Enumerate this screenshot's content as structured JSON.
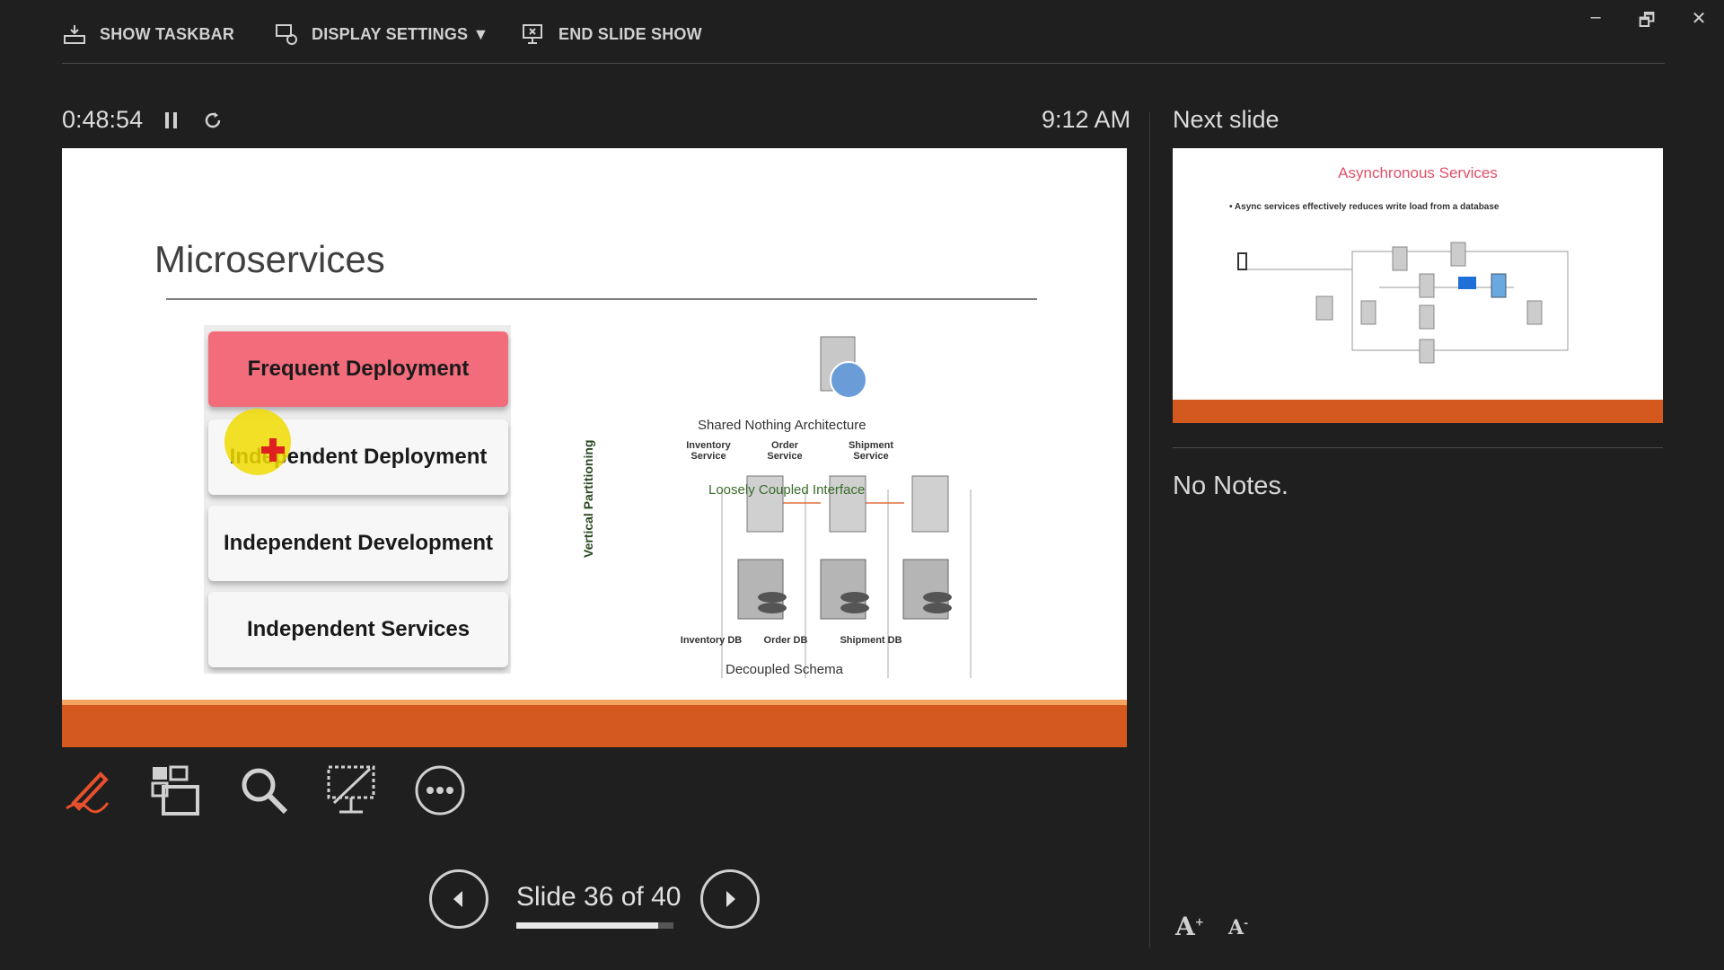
{
  "toolbar": {
    "show_taskbar": "SHOW TASKBAR",
    "display_settings": "DISPLAY SETTINGS ▼",
    "end_slide_show": "END SLIDE SHOW"
  },
  "window_controls": {
    "minimize": "–",
    "restore": "🗗",
    "close": "✕"
  },
  "presenter": {
    "elapsed": "0:48:54",
    "clock": "9:12 AM",
    "next_slide_label": "Next slide",
    "notes": "No Notes.",
    "slide_counter": "Slide 36 of 40",
    "progress_fraction": 0.9
  },
  "current_slide": {
    "title": "Microservices",
    "boxes": [
      "Frequent Deployment",
      "Independent Deployment",
      "Independent Development",
      "Independent Services"
    ],
    "diagram": {
      "header": "Shared Nothing Architecture",
      "services": [
        "Inventory Service",
        "Order Service",
        "Shipment Service"
      ],
      "interface": "Loosely Coupled Interface",
      "side_label": "Vertical Partitioning",
      "dbs": [
        "Inventory DB",
        "Order DB",
        "Shipment DB"
      ],
      "footer": "Decoupled Schema"
    }
  },
  "next_slide": {
    "title": "Asynchronous Services",
    "bullet": "• Async services effectively reduces write load from a database"
  },
  "colors": {
    "accent_orange": "#d4591f",
    "highlight_red": "#f36c7c",
    "pen_orange": "#e8502c"
  },
  "icons": [
    "taskbar-icon",
    "display-settings-icon",
    "end-show-icon",
    "pause-icon",
    "restart-icon",
    "pen-icon",
    "slides-grid-icon",
    "zoom-icon",
    "black-screen-icon",
    "more-icon",
    "prev-arrow-icon",
    "next-arrow-icon",
    "font-increase-icon",
    "font-decrease-icon"
  ]
}
